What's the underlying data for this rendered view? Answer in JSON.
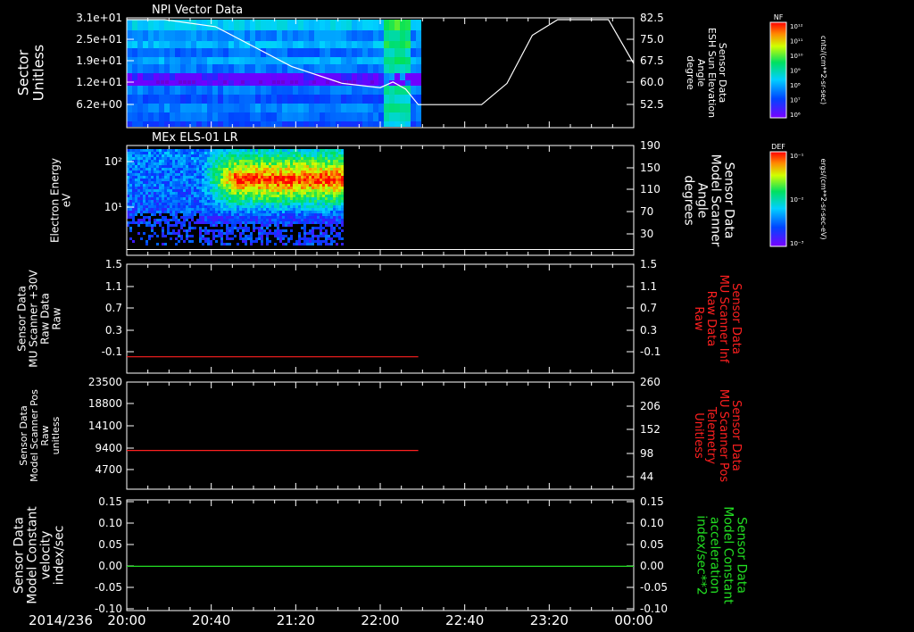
{
  "date_label": "2014/236",
  "time_ticks": [
    "20:00",
    "20:40",
    "21:20",
    "22:00",
    "22:40",
    "23:20",
    "00:00"
  ],
  "colorbars": [
    {
      "badge": "NF",
      "unit": "cnts/(cm**2-sr-sec)",
      "ticks": [
        "10¹²",
        "10¹¹",
        "10¹⁰",
        "10⁹",
        "10⁸",
        "10⁷",
        "10⁶"
      ]
    },
    {
      "badge": "DEF",
      "unit": "ergs/(cm**2-sr-sec-eV)",
      "ticks": [
        "10⁻¹",
        "10⁻²",
        "10⁻³"
      ]
    }
  ],
  "panels": [
    {
      "title": "NPI Vector Data",
      "left_label": [
        "Sector",
        "Unitless"
      ],
      "left_ticks": [
        "3.1e+01",
        "2.5e+01",
        "1.9e+01",
        "1.2e+01",
        "6.2e+00"
      ],
      "right_label": [
        "Sensor Data",
        "ESH Sun Elevation",
        "Angle",
        "degree"
      ],
      "right_ticks": [
        "82.5",
        "75.0",
        "67.5",
        "60.0",
        "52.5"
      ],
      "right_color": "#ffffff",
      "line_color": "#ffffff"
    },
    {
      "title": "MEx ELS-01 LR",
      "left_label": [
        "Electron Energy",
        "eV"
      ],
      "left_ticks": [
        "10²",
        "10¹"
      ],
      "right_label": [
        "Sensor Data",
        "Model Scanner",
        "Angle",
        "degrees"
      ],
      "right_ticks": [
        "190",
        "150",
        "110",
        "70",
        "30"
      ],
      "right_color": "#ffffff",
      "line_color": "#ffffff"
    },
    {
      "title": "",
      "left_label": [
        "Sensor Data",
        "MU Scanner +30V",
        "Raw Data",
        "Raw"
      ],
      "left_ticks": [
        "1.5",
        "1.1",
        "0.7",
        "0.3",
        "-0.1"
      ],
      "right_label": [
        "Sensor Data",
        "MU Scanner Inf",
        "Raw Data",
        "Raw"
      ],
      "right_ticks": [
        "1.5",
        "1.1",
        "0.7",
        "0.3",
        "-0.1"
      ],
      "right_color": "#ff2020",
      "line_color": "#ff2020"
    },
    {
      "title": "",
      "left_label": [
        "Sensor Data",
        "Model Scanner Pos",
        "Raw",
        "unitless"
      ],
      "left_ticks": [
        "23500",
        "18800",
        "14100",
        "9400",
        "4700"
      ],
      "right_label": [
        "Sensor Data",
        "MU Scanner Pos",
        "Telemetry",
        "Unitless"
      ],
      "right_ticks": [
        "260",
        "206",
        "152",
        "98",
        "44"
      ],
      "right_color": "#ff2020",
      "line_color": "#ff2020"
    },
    {
      "title": "",
      "left_label": [
        "Sensor Data",
        "Model Constant",
        "velocity",
        "index/sec"
      ],
      "left_ticks": [
        "0.15",
        "0.10",
        "0.05",
        "0.00",
        "-0.05",
        "-0.10"
      ],
      "right_label": [
        "Sensor Data",
        "Model Constant",
        "acceleration",
        "index/sec**2"
      ],
      "right_ticks": [
        "0.15",
        "0.10",
        "0.05",
        "0.00",
        "-0.05",
        "-0.10"
      ],
      "right_color": "#22dd22",
      "line_color": "#22dd22"
    }
  ],
  "chart_data": [
    {
      "type": "heatmap",
      "title": "NPI Vector Data",
      "x_range": [
        "20:00",
        "00:00"
      ],
      "y_label": "Sector Unitless",
      "y_ticks": [
        31,
        25,
        19,
        12,
        6.2
      ],
      "data_extent_x": [
        "20:00",
        "22:12"
      ],
      "overlay_series": {
        "name": "Sensor Data ESH Sun Elevation Angle",
        "unit": "degree",
        "x_hours": [
          0,
          0.3,
          0.7,
          1.0,
          1.3,
          1.7,
          2.0,
          2.1,
          2.2,
          2.3,
          2.4,
          2.8,
          3.0,
          3.2,
          3.4,
          3.8,
          4.0
        ],
        "y": [
          82.5,
          82.5,
          80,
          73,
          66,
          60,
          58.5,
          60.5,
          58,
          52.5,
          52.5,
          52.5,
          60,
          77,
          82.5,
          82.5,
          67
        ],
        "ylim": [
          45,
          82.5
        ]
      }
    },
    {
      "type": "heatmap",
      "title": "MEx ELS-01 LR",
      "x_range": [
        "20:00",
        "00:00"
      ],
      "y_label": "Electron Energy eV",
      "y_scale": "log",
      "data_extent_x": [
        "20:00",
        "21:47"
      ],
      "overlay_series": {
        "name": "Sensor Data Model Scanner Angle",
        "unit": "degrees",
        "x_hours": [
          0,
          4.0
        ],
        "y": [
          10,
          10
        ],
        "ylim": [
          0,
          190
        ]
      }
    },
    {
      "type": "line",
      "x_range": [
        "20:00",
        "00:00"
      ],
      "series": [
        {
          "name": "Sensor Data MU Scanner +30V Raw Data",
          "x_hours": [
            0,
            2.3
          ],
          "y": [
            -0.03,
            -0.03
          ]
        }
      ],
      "ylim": [
        -0.3,
        1.5
      ]
    },
    {
      "type": "line",
      "x_range": [
        "20:00",
        "00:00"
      ],
      "series": [
        {
          "name": "Sensor Data Model Scanner Pos Raw",
          "x_hours": [
            0,
            2.3
          ],
          "y": [
            8500,
            8500
          ]
        }
      ],
      "ylim": [
        0,
        23500
      ]
    },
    {
      "type": "line",
      "x_range": [
        "20:00",
        "00:00"
      ],
      "series": [
        {
          "name": "Sensor Data Model Constant velocity",
          "x_hours": [
            0,
            4.0
          ],
          "y": [
            0,
            0
          ]
        }
      ],
      "ylim": [
        -0.1,
        0.15
      ]
    }
  ]
}
